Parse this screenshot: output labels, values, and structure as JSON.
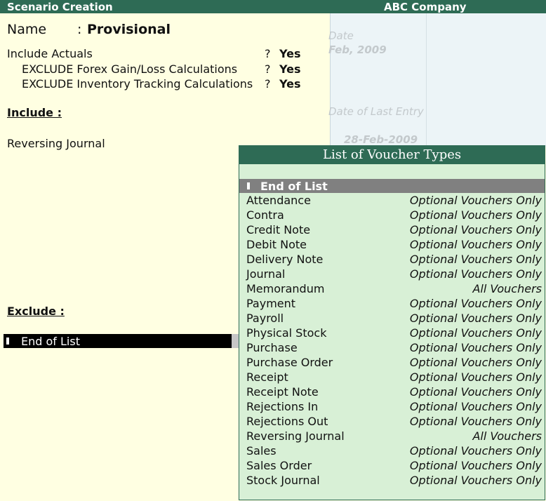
{
  "header": {
    "title": "Scenario Creation",
    "company": "ABC Company"
  },
  "background_ghost": {
    "date_label": "Date",
    "date_value": "Feb, 2009",
    "last_entry_label": "Date of Last Entry",
    "last_entry_value": "28-Feb-2009"
  },
  "form": {
    "name_label": "Name",
    "name_colon": ":",
    "name_value": "Provisional",
    "include_actuals_label": "Include Actuals",
    "include_actuals_q": "?",
    "include_actuals_value": "Yes",
    "exclude_forex_label": "EXCLUDE Forex Gain/Loss Calculations",
    "exclude_forex_q": "?",
    "exclude_forex_value": "Yes",
    "exclude_inventory_label": "EXCLUDE Inventory Tracking Calculations",
    "exclude_inventory_q": "?",
    "exclude_inventory_value": "Yes",
    "include_heading": "Include :",
    "include_item": "Reversing Journal",
    "exclude_heading": "Exclude :",
    "exclude_end_of_list": "End of List"
  },
  "popup": {
    "title": "List of Voucher Types",
    "end_of_list": "End of List",
    "items": [
      {
        "name": "Attendance",
        "type": "Optional Vouchers Only"
      },
      {
        "name": "Contra",
        "type": "Optional Vouchers Only"
      },
      {
        "name": "Credit Note",
        "type": "Optional Vouchers Only"
      },
      {
        "name": "Debit Note",
        "type": "Optional Vouchers Only"
      },
      {
        "name": "Delivery Note",
        "type": "Optional Vouchers Only"
      },
      {
        "name": "Journal",
        "type": "Optional Vouchers Only"
      },
      {
        "name": "Memorandum",
        "type": "All Vouchers"
      },
      {
        "name": "Payment",
        "type": "Optional Vouchers Only"
      },
      {
        "name": "Payroll",
        "type": "Optional Vouchers Only"
      },
      {
        "name": "Physical Stock",
        "type": "Optional Vouchers Only"
      },
      {
        "name": "Purchase",
        "type": "Optional Vouchers Only"
      },
      {
        "name": "Purchase Order",
        "type": "Optional Vouchers Only"
      },
      {
        "name": "Receipt",
        "type": "Optional Vouchers Only"
      },
      {
        "name": "Receipt Note",
        "type": "Optional Vouchers Only"
      },
      {
        "name": "Rejections In",
        "type": "Optional Vouchers Only"
      },
      {
        "name": "Rejections Out",
        "type": "Optional Vouchers Only"
      },
      {
        "name": "Reversing Journal",
        "type": "All Vouchers"
      },
      {
        "name": "Sales",
        "type": "Optional Vouchers Only"
      },
      {
        "name": "Sales Order",
        "type": "Optional Vouchers Only"
      },
      {
        "name": "Stock Journal",
        "type": "Optional Vouchers Only"
      }
    ]
  }
}
